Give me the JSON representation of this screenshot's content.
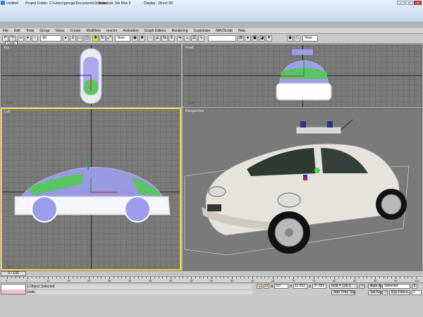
{
  "title_bar": {
    "segments": [
      "Untitled",
      "Project Folder: C:\\Users\\george\\Documents\\3dsmax",
      "Autodesk 3ds Max 9",
      "Display : Direct 3D"
    ]
  },
  "menu": [
    "File",
    "Edit",
    "Tools",
    "Group",
    "Views",
    "Create",
    "Modifiers",
    "reactor",
    "Animation",
    "Graph Editors",
    "Rendering",
    "Customize",
    "MAXScript",
    "Help"
  ],
  "toolbar": {
    "selection_filter": "All",
    "reference_coord": "View",
    "named_selection": "View",
    "tooltip": "Undo"
  },
  "viewports": {
    "top": "Top",
    "front": "Front",
    "left": "Left",
    "perspective": "Perspective"
  },
  "time_slider": {
    "label": "0 / 100"
  },
  "trackbar": {
    "ticks": [
      "0",
      "5",
      "10",
      "15",
      "20",
      "25",
      "30",
      "35",
      "40",
      "45",
      "50",
      "55",
      "60",
      "65",
      "70",
      "75",
      "80",
      "85",
      "90",
      "95",
      "100"
    ]
  },
  "status": {
    "selection": "1 Object Selected",
    "prompt": "Undo",
    "x_label": "X",
    "x_value": "0.0",
    "y_label": "Y",
    "y_value": "11.502",
    "z_label": "Z",
    "z_value": "37.681",
    "grid": "Grid = 100.0",
    "add_time_tag": "Add Time Tag",
    "auto_key": "Auto Key",
    "set_key": "Set Key",
    "key_filters": "Key Filters...",
    "key_mode_value": "Selected",
    "frame_value": "0"
  },
  "colors": {
    "active_border": "#e8d44a",
    "car_body": "#e6e2dc",
    "wireframe_blue": "#8f8fe8",
    "wireframe_green": "#44d544"
  }
}
